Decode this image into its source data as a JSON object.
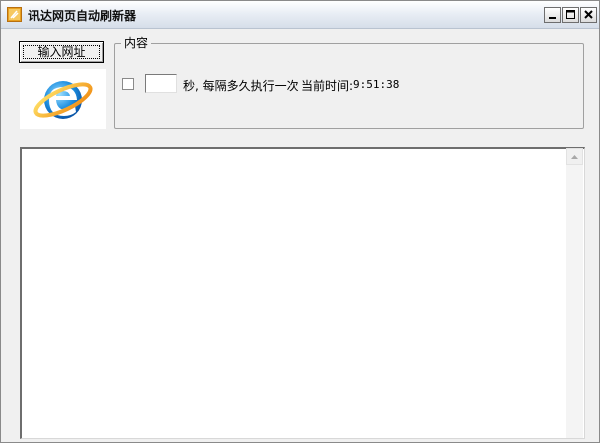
{
  "window": {
    "title": "讯达网页自动刷新器",
    "icon": "app-icon",
    "controls": [
      "minimize-icon",
      "maximize-icon",
      "close-icon"
    ]
  },
  "left_panel": {
    "url_button_label": "输入网址",
    "logo": "ie-logo-icon"
  },
  "group": {
    "title": "内容",
    "checkbox_checked": false,
    "seconds_value": "",
    "interval_label": "秒, 每隔多久执行一次",
    "current_time_label": "当前时间:",
    "current_time_value": "9:51:38"
  },
  "content": {
    "text": ""
  }
}
